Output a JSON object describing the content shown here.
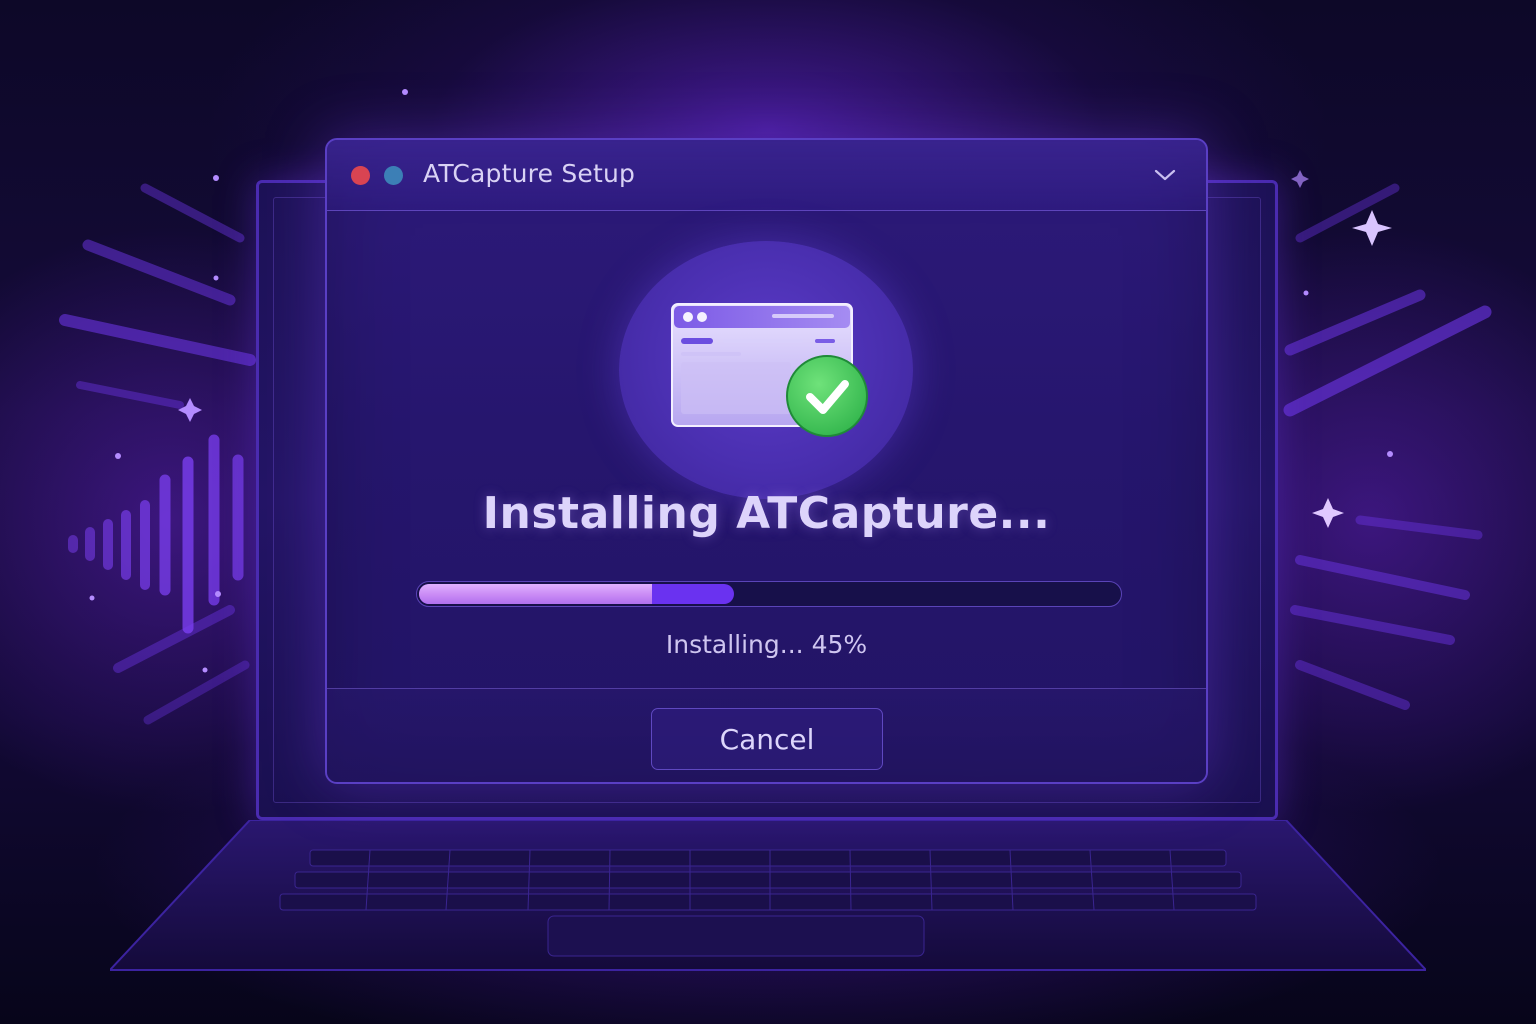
{
  "window": {
    "title": "ATCapture Setup"
  },
  "installer": {
    "heading": "Installing ATCapture...",
    "progress_percent": 45,
    "status_text": "Installing... 45%"
  },
  "buttons": {
    "cancel_label": "Cancel"
  },
  "icons": {
    "window_controls": [
      "close-dot-icon",
      "minimize-dot-icon"
    ],
    "titlebar": "chevron-down-icon",
    "app": "app-window-icon",
    "badge": "checkmark-icon"
  },
  "colors": {
    "accent": "#6a32f0",
    "progress_highlight": "#c98af5",
    "close_dot": "#d94452",
    "minimize_dot": "#3c7fb6",
    "check_badge": "#34c759",
    "background": "#150b3a"
  }
}
